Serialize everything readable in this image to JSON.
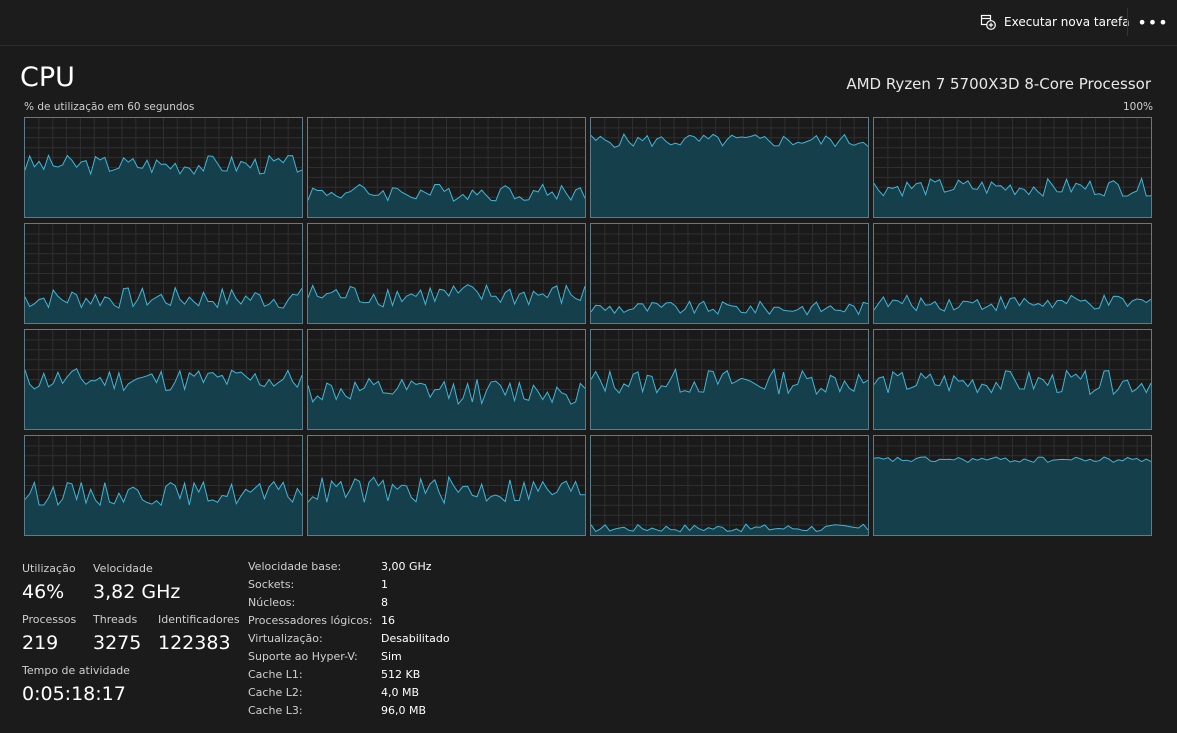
{
  "toolbar": {
    "run_task_label": "Executar nova tarefa",
    "run_task_icon": "new-task-icon",
    "more_label": "•••",
    "more_icon": "more-options-icon"
  },
  "header": {
    "title": "CPU",
    "processor_name": "AMD Ryzen 7 5700X3D 8-Core Processor"
  },
  "chart": {
    "caption": "% de utilização em 60 segundos",
    "max_label": "100%",
    "line_color": "#3fb6d8",
    "fill_color": "#163f4c",
    "border_color": "#5c7c8a",
    "grid_color": "#2f2f2f"
  },
  "chart_data": {
    "type": "area",
    "title": "% de utilização em 60 segundos",
    "ylim": [
      0,
      100
    ],
    "ymax_label": "100%",
    "grid": true,
    "layout": "4x4 logical processors",
    "series": [
      {
        "base": 53,
        "amp": 10
      },
      {
        "base": 25,
        "amp": 9
      },
      {
        "base": 77,
        "amp": 7
      },
      {
        "base": 30,
        "amp": 9
      },
      {
        "base": 25,
        "amp": 11
      },
      {
        "base": 28,
        "amp": 12
      },
      {
        "base": 15,
        "amp": 7
      },
      {
        "base": 20,
        "amp": 8
      },
      {
        "base": 50,
        "amp": 12
      },
      {
        "base": 38,
        "amp": 13
      },
      {
        "base": 48,
        "amp": 13
      },
      {
        "base": 47,
        "amp": 12
      },
      {
        "base": 42,
        "amp": 12
      },
      {
        "base": 45,
        "amp": 14
      },
      {
        "base": 7,
        "amp": 4
      },
      {
        "base": 76,
        "amp": 3
      }
    ]
  },
  "stats": {
    "utilization_label": "Utilização",
    "utilization_value": "46%",
    "speed_label": "Velocidade",
    "speed_value": "3,82 GHz",
    "processes_label": "Processos",
    "processes_value": "219",
    "threads_label": "Threads",
    "threads_value": "3275",
    "handles_label": "Identificadores",
    "handles_value": "122383",
    "uptime_label": "Tempo de atividade",
    "uptime_value": "0:05:18:17"
  },
  "specs": [
    {
      "key": "Velocidade base:",
      "value": "3,00 GHz"
    },
    {
      "key": "Sockets:",
      "value": "1"
    },
    {
      "key": "Núcleos:",
      "value": "8"
    },
    {
      "key": "Processadores lógicos:",
      "value": "16"
    },
    {
      "key": "Virtualização:",
      "value": "Desabilitado"
    },
    {
      "key": "Suporte ao Hyper-V:",
      "value": "Sim"
    },
    {
      "key": "Cache L1:",
      "value": "512 KB"
    },
    {
      "key": "Cache L2:",
      "value": "4,0 MB"
    },
    {
      "key": "Cache L3:",
      "value": "96,0 MB"
    }
  ]
}
